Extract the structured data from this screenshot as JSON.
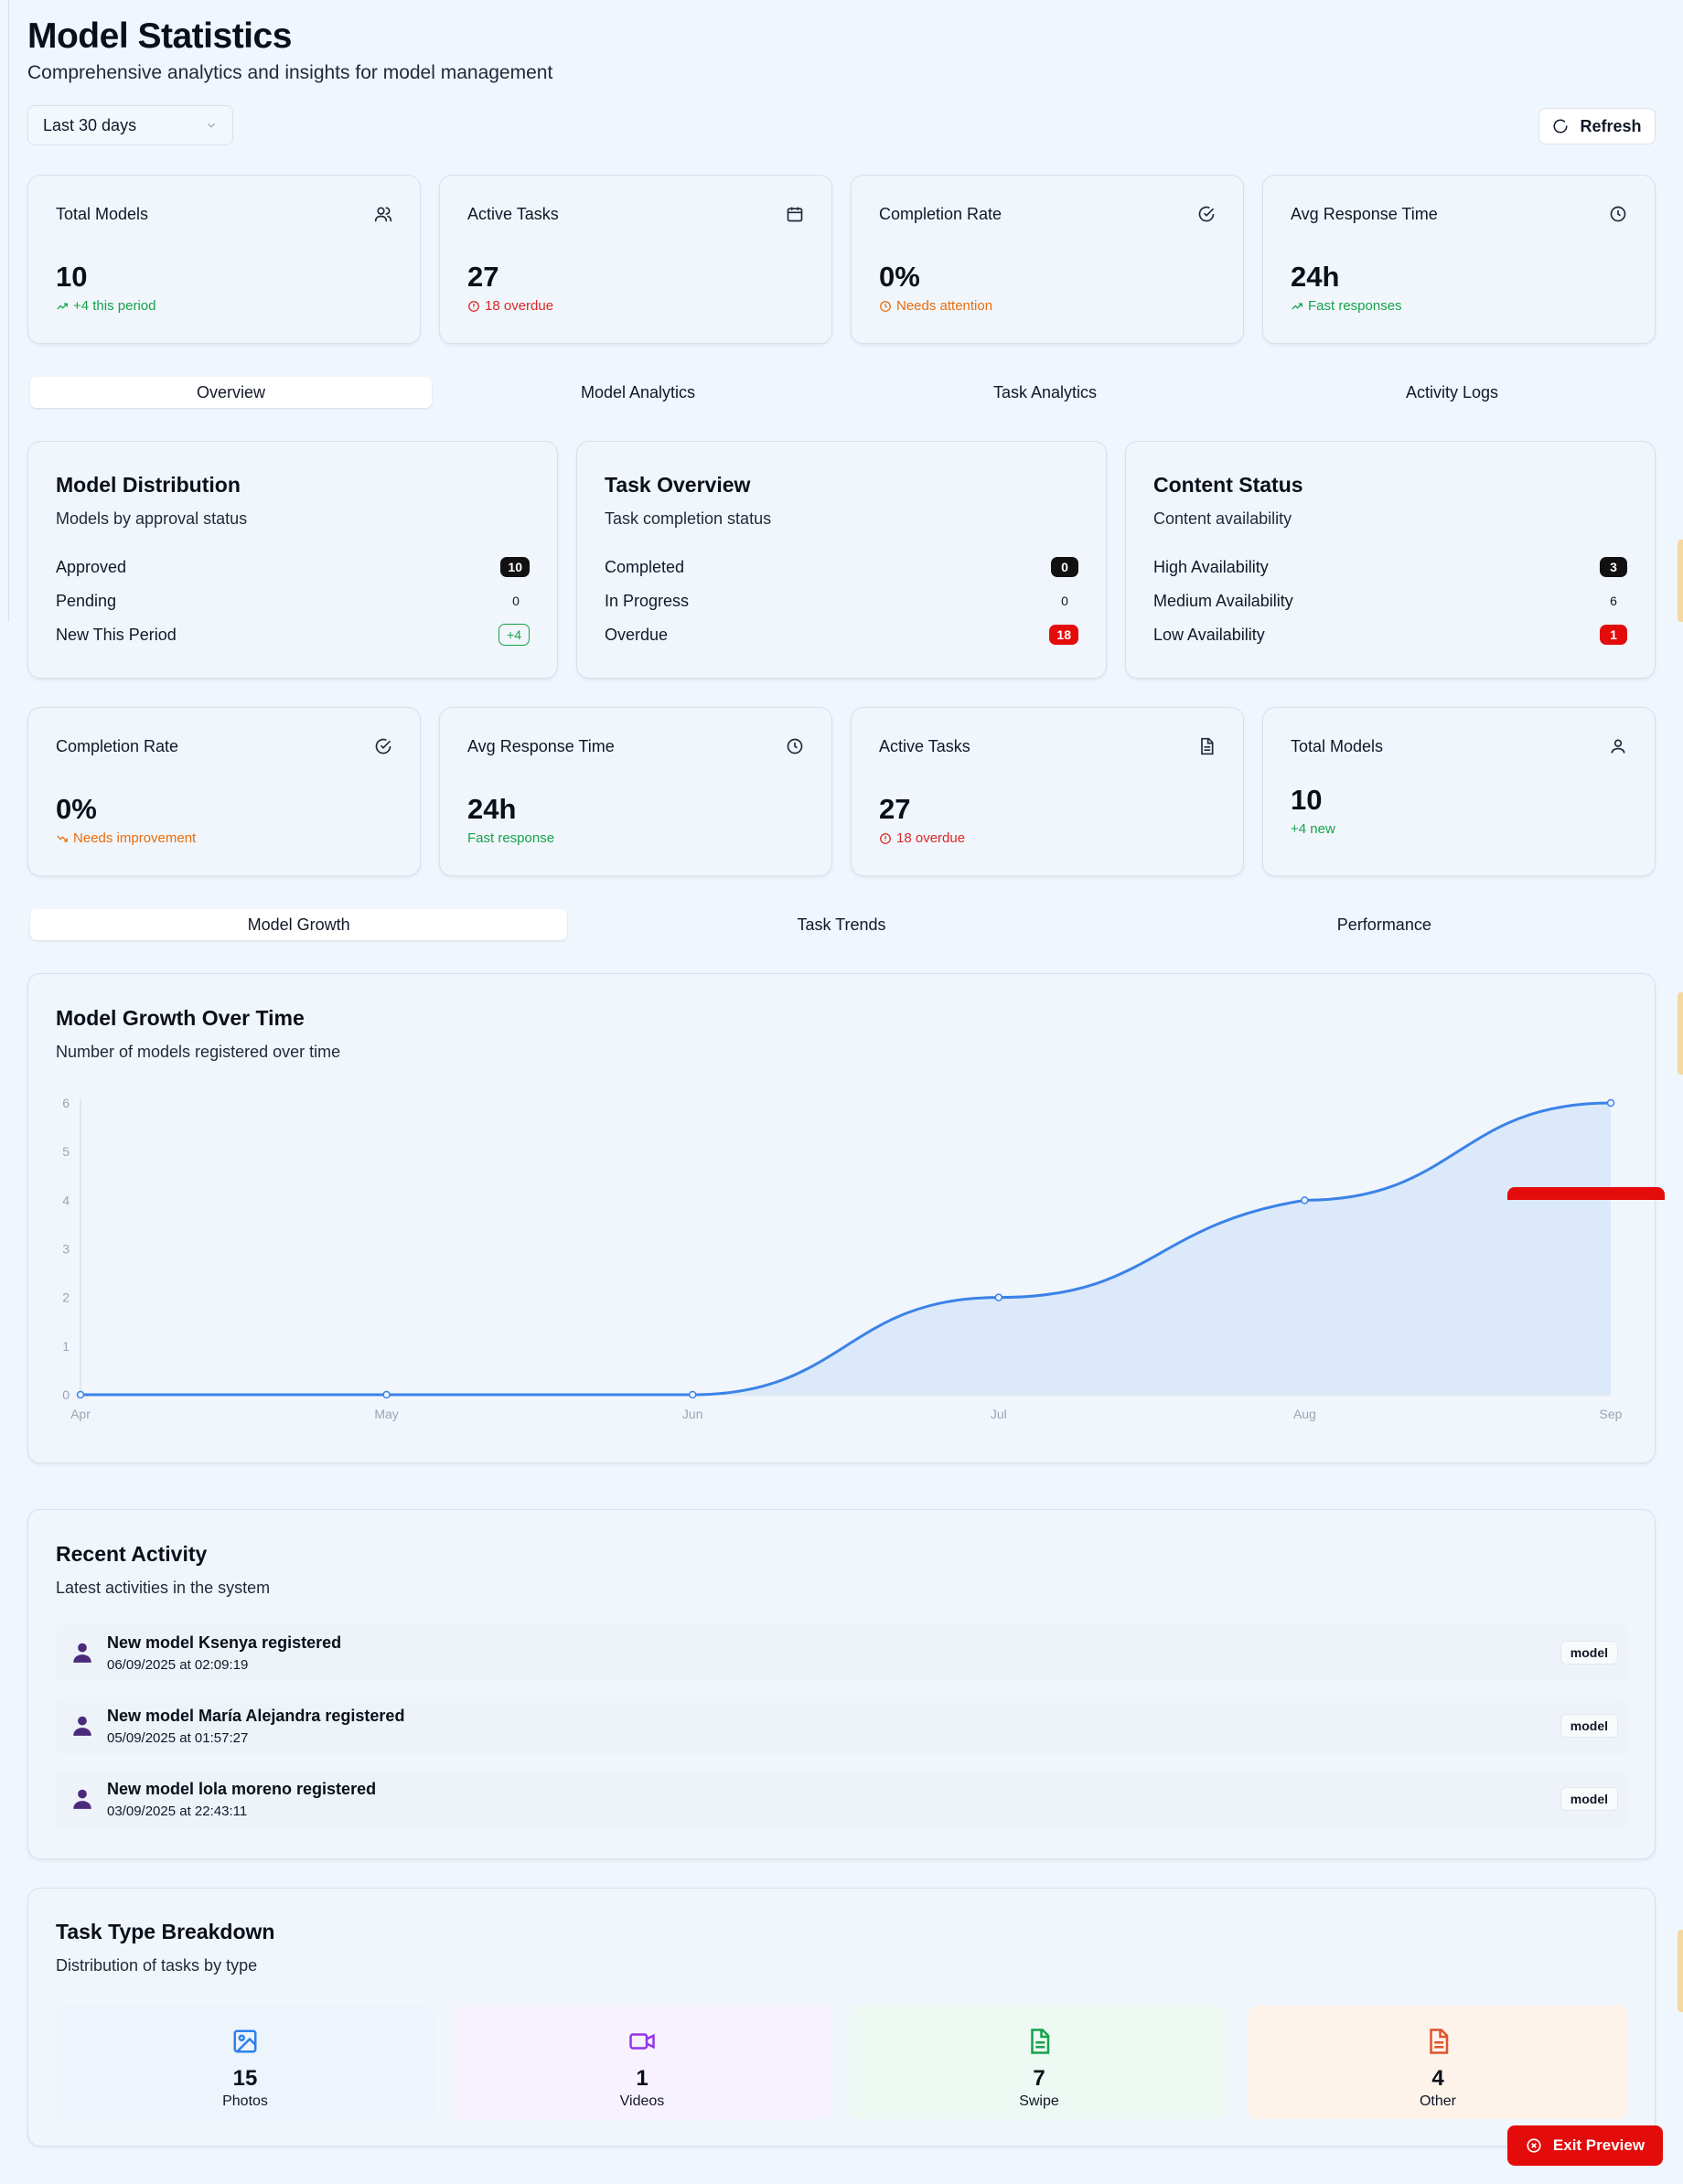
{
  "page": {
    "title": "Model Statistics",
    "subtitle": "Comprehensive analytics and insights for model management"
  },
  "controls": {
    "date_range": "Last 30 days",
    "refresh_label": "Refresh"
  },
  "top_stats": [
    {
      "label": "Total Models",
      "value": "10",
      "note": "+4 this period",
      "icon": "users-icon"
    },
    {
      "label": "Active Tasks",
      "value": "27",
      "note": "18 overdue",
      "icon": "calendar-icon"
    },
    {
      "label": "Completion Rate",
      "value": "0%",
      "note": "Needs attention",
      "icon": "check-circle-icon"
    },
    {
      "label": "Avg Response Time",
      "value": "24h",
      "note": "Fast responses",
      "icon": "clock-icon"
    }
  ],
  "main_tabs": [
    "Overview",
    "Model Analytics",
    "Task Analytics",
    "Activity Logs"
  ],
  "model_distribution": {
    "title": "Model Distribution",
    "subtitle": "Models by approval status",
    "rows": [
      {
        "label": "Approved",
        "value": "10"
      },
      {
        "label": "Pending",
        "value": "0"
      },
      {
        "label": "New This Period",
        "value": "+4"
      }
    ]
  },
  "task_overview": {
    "title": "Task Overview",
    "subtitle": "Task completion status",
    "rows": [
      {
        "label": "Completed",
        "value": "0"
      },
      {
        "label": "In Progress",
        "value": "0"
      },
      {
        "label": "Overdue",
        "value": "18"
      }
    ]
  },
  "content_status": {
    "title": "Content Status",
    "subtitle": "Content availability",
    "rows": [
      {
        "label": "High Availability",
        "value": "3"
      },
      {
        "label": "Medium Availability",
        "value": "6"
      },
      {
        "label": "Low Availability",
        "value": "1"
      }
    ]
  },
  "second_stats": [
    {
      "label": "Completion Rate",
      "value": "0%",
      "note": "Needs improvement",
      "icon": "check-circle-icon"
    },
    {
      "label": "Avg Response Time",
      "value": "24h",
      "note": "Fast response",
      "icon": "clock-icon"
    },
    {
      "label": "Active Tasks",
      "value": "27",
      "note": "18 overdue",
      "icon": "document-icon"
    },
    {
      "label": "Total Models",
      "value": "10",
      "note": "+4 new",
      "icon": "user-icon"
    }
  ],
  "chart_tabs": [
    "Model Growth",
    "Task Trends",
    "Performance"
  ],
  "growth_chart": {
    "title": "Model Growth Over Time",
    "subtitle": "Number of models registered over time"
  },
  "chart_data": {
    "type": "area",
    "categories": [
      "Apr",
      "May",
      "Jun",
      "Jul",
      "Aug",
      "Sep"
    ],
    "values": [
      0,
      0,
      0,
      2,
      4,
      6
    ],
    "ylim": [
      0,
      6
    ],
    "yticks": [
      0,
      1,
      2,
      3,
      4,
      5,
      6
    ],
    "line_color": "#3b82e8",
    "fill_color": "#dbe9fa",
    "grid": false
  },
  "recent_activity": {
    "title": "Recent Activity",
    "subtitle": "Latest activities in the system",
    "items": [
      {
        "title": "New model Ksenya registered",
        "time": "06/09/2025 at 02:09:19",
        "tag": "model"
      },
      {
        "title": "New model María Alejandra registered",
        "time": "05/09/2025 at 01:57:27",
        "tag": "model"
      },
      {
        "title": "New model lola moreno registered",
        "time": "03/09/2025 at 22:43:11",
        "tag": "model"
      }
    ]
  },
  "task_breakdown": {
    "title": "Task Type Breakdown",
    "subtitle": "Distribution of tasks by type",
    "types": [
      {
        "count": "15",
        "label": "Photos",
        "icon": "image-icon",
        "color": "#2f80ed",
        "bg": "#edf4fc"
      },
      {
        "count": "1",
        "label": "Videos",
        "icon": "video-icon",
        "color": "#9333ea",
        "bg": "#f7f2fd"
      },
      {
        "count": "7",
        "label": "Swipe",
        "icon": "file-text-icon",
        "color": "#16a34a",
        "bg": "#edf9f2"
      },
      {
        "count": "4",
        "label": "Other",
        "icon": "file-text-icon",
        "color": "#e2522e",
        "bg": "#fdf3ea"
      }
    ]
  },
  "exit_preview_label": "Exit Preview"
}
